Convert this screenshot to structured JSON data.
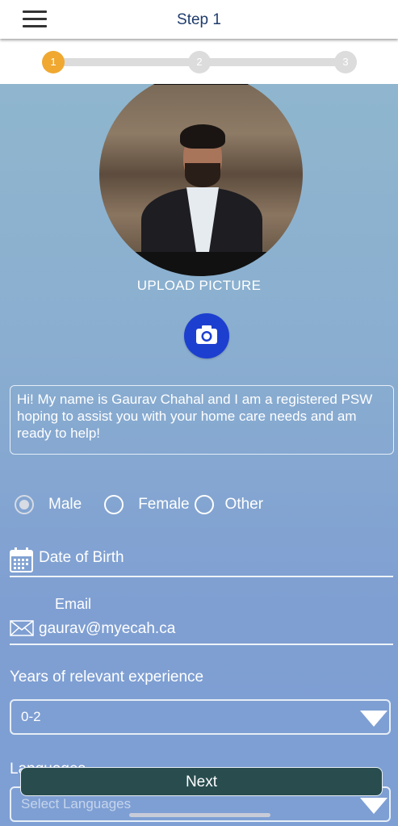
{
  "header": {
    "title": "Step 1",
    "menu_icon": "hamburger-menu-icon"
  },
  "stepper": {
    "steps": [
      "1",
      "2",
      "3"
    ],
    "active_step": 1
  },
  "profile": {
    "upload_label": "UPLOAD PICTURE",
    "camera_icon": "camera-icon",
    "camera_button_color": "#1d3fd0"
  },
  "bio": "Hi! My name is Gaurav Chahal and I am a registered PSW hoping to assist you with your home care needs and am ready to help!",
  "gender": {
    "options": [
      "Male",
      "Female",
      "Other"
    ],
    "selected": "Male"
  },
  "dob": {
    "placeholder": "Date of Birth",
    "icon": "calendar-icon"
  },
  "email": {
    "label": "Email",
    "value": "gaurav@myecah.ca",
    "icon": "mail-icon"
  },
  "experience": {
    "label": "Years of relevant experience",
    "value": "0-2"
  },
  "languages": {
    "label": "Languages",
    "placeholder": "Select Languages"
  },
  "next_button": {
    "label": "Next",
    "color": "#294d4f"
  },
  "colors": {
    "active_step": "#f0a830",
    "accent_blue": "#1d3fd0"
  }
}
